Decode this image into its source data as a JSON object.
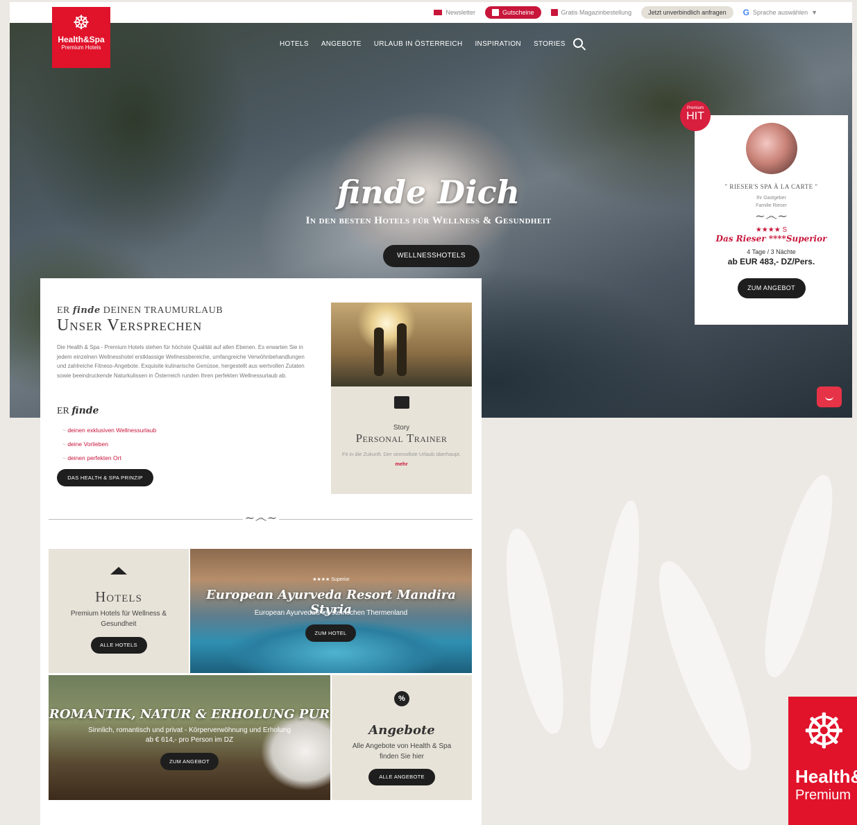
{
  "topbar": {
    "newsletter": "Newsletter",
    "gutscheine": "Gutscheine",
    "magazin": "Gratis Magazinbestellung",
    "anfragen": "Jetzt unverbindlich anfragen",
    "language": "Sprache auswählen",
    "language_arrow": "▼"
  },
  "logo": {
    "icon": "yoga-figure-icon",
    "line1": "Health&Spa",
    "line2": "Premium Hotels"
  },
  "nav": [
    "HOTELS",
    "ANGEBOTE",
    "URLAUB IN ÖSTERREICH",
    "INSPIRATION",
    "STORIES"
  ],
  "hero": {
    "title": "finde Dich",
    "subtitle": "In den besten Hotels für Wellness & Gesundheit",
    "button": "WELLNESSHOTELS"
  },
  "promo": {
    "badge_small": "Premium",
    "badge_big": "HIT",
    "name": "\" RIESER'S SPA À LA CARTE \"",
    "host_line1": "Ihr Gastgeber",
    "host_line2": "Familie Rieser",
    "stars": "★★★★ S",
    "hotel": "Das Rieser ****Superior",
    "nights": "4 Tage / 3 Nächte",
    "price": "ab EUR 483,- DZ/Pers.",
    "button": "ZUM ANGEBOT"
  },
  "intro": {
    "kicker_pre": "ER",
    "kicker_finde": "finde",
    "kicker_post": "DEINEN TRAUMURLAUB",
    "title": "Unser Versprechen",
    "text": "Die Health & Spa - Premium Hotels stehen für höchste Qualität auf allen Ebenen. Es erwarten Sie in jedem einzelnen Wellnesshotel erstklassige Wellnessbereiche, umfangreiche Verwöhnbehandlungen und zahlreiche Fitness-Angebote. Exquisite kulinarische Genüsse, hergestellt aus wertvollen Zutaten sowie beeindruckende Naturkulissen in Österreich runden Ihren perfekten Wellnessurlaub ab.",
    "erfinde_pre": "ER",
    "erfinde": "finde",
    "list": [
      "deinen exklusiven Wellnessurlaub",
      "deine Vorlieben",
      "deinen perfekten Ort"
    ],
    "button": "DAS HEALTH & SPA PRINZIP"
  },
  "story": {
    "label": "Story",
    "title": "Personal Trainer",
    "text": "Fit in die Zukunft. Der sinnvollste Urlaub überhaupt.",
    "more": "mehr"
  },
  "hotels": {
    "title": "Hotels",
    "text_line1": "Premium Hotels für Wellness &",
    "text_line2": "Gesundheit",
    "button": "ALLE HOTELS"
  },
  "pool": {
    "stars": "★★★★ Superior",
    "title": "European Ayurveda Resort Mandira Styria",
    "text": "European Ayurveda® im steirischen Thermenland",
    "button": "ZUM HOTEL"
  },
  "carriage": {
    "title": "ROMANTIK, NATUR & ERHOLUNG PUR",
    "text_line1": "Sinnlich, romantisch und privat - Körperverwöhnung und Erholung",
    "text_line2": "ab € 614,- pro Person im DZ",
    "button": "ZUM ANGEBOT"
  },
  "angebote": {
    "icon": "%",
    "title": "Angebote",
    "text_line1": "Alle Angebote von Health & Spa",
    "text_line2": "finden Sie hier",
    "button": "ALLE ANGEBOTE"
  },
  "corner_logo": {
    "line1": "Health&",
    "line2": "Premium"
  }
}
